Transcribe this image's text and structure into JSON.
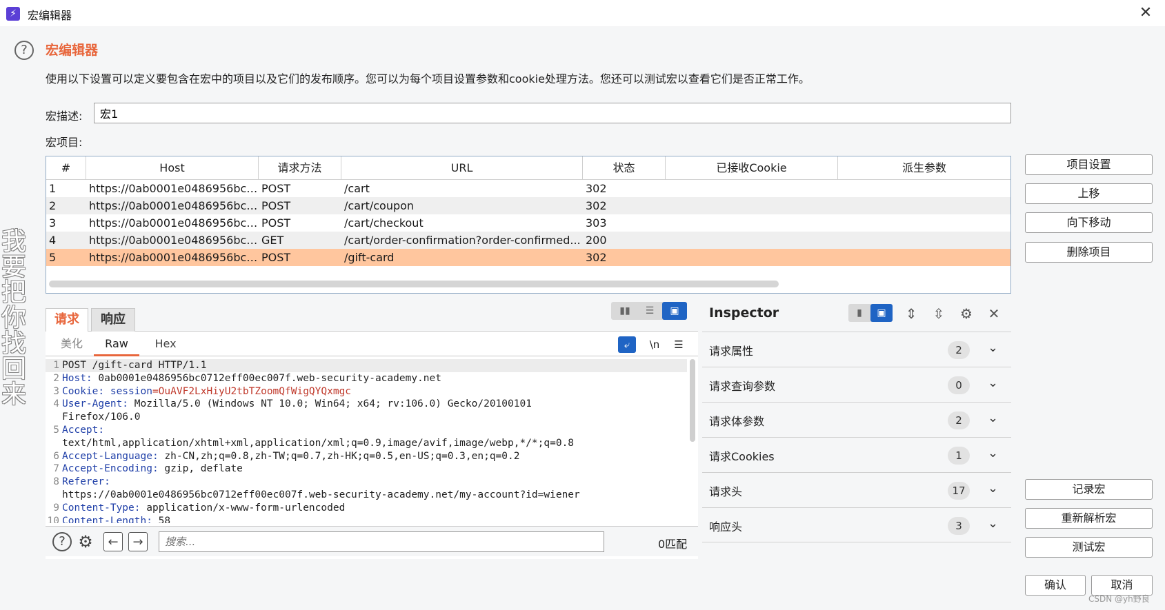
{
  "window": {
    "title": "宏编辑器",
    "close_glyph": "✕"
  },
  "header": {
    "help_glyph": "?",
    "heading": "宏编辑器",
    "description": "使用以下设置可以定义要包含在宏中的项目以及它们的发布顺序。您可以为每个项目设置参数和cookie处理方法。您还可以测试宏以查看它们是否正常工作。"
  },
  "form": {
    "desc_label": "宏描述:",
    "desc_value": "宏1",
    "items_label": "宏项目:"
  },
  "table": {
    "columns": [
      "#",
      "Host",
      "请求方法",
      "URL",
      "状态",
      "已接收Cookie",
      "派生参数"
    ],
    "rows": [
      [
        "1",
        "https://0ab0001e0486956bc07...",
        "POST",
        "/cart",
        "302",
        "",
        ""
      ],
      [
        "2",
        "https://0ab0001e0486956bc07...",
        "POST",
        "/cart/coupon",
        "302",
        "",
        ""
      ],
      [
        "3",
        "https://0ab0001e0486956bc07...",
        "POST",
        "/cart/checkout",
        "303",
        "",
        ""
      ],
      [
        "4",
        "https://0ab0001e0486956bc07...",
        "GET",
        "/cart/order-confirmation?order-confirmed...",
        "200",
        "",
        ""
      ],
      [
        "5",
        "https://0ab0001e0486956bc07...",
        "POST",
        "/gift-card",
        "302",
        "",
        ""
      ]
    ],
    "selected_row": 5
  },
  "side_buttons": {
    "item_settings": "项目设置",
    "move_up": "上移",
    "move_down": "向下移动",
    "delete_item": "删除项目",
    "record_macro": "记录宏",
    "reparse_macro": "重新解析宏",
    "test_macro": "测试宏",
    "ok": "确认",
    "cancel": "取消"
  },
  "watermark": "我要把你找回来",
  "request_panel": {
    "tabs": {
      "request": "请求",
      "response": "响应"
    },
    "subtabs": {
      "pretty": "美化",
      "raw": "Raw",
      "hex": "Hex"
    },
    "newline_toggle": "\\n",
    "menu_glyph": "☰",
    "lines": [
      {
        "n": "1",
        "key": "",
        "val": "POST /gift-card HTTP/1.1"
      },
      {
        "n": "2",
        "key": "Host:",
        "val": " 0ab0001e0486956bc0712eff00ec007f.web-security-academy.net"
      },
      {
        "n": "3",
        "key": "Cookie:",
        "val": " ",
        "cookie_name": "session",
        "cookie_value": "=OuAVF2LxHiyU2tbTZoomQfWigQYQxmgc"
      },
      {
        "n": "4",
        "key": "User-Agent:",
        "val": " Mozilla/5.0 (Windows NT 10.0; Win64; x64; rv:106.0) Gecko/20100101"
      },
      {
        "n": "",
        "key": "",
        "val": "Firefox/106.0"
      },
      {
        "n": "5",
        "key": "Accept:",
        "val": ""
      },
      {
        "n": "",
        "key": "",
        "val": "text/html,application/xhtml+xml,application/xml;q=0.9,image/avif,image/webp,*/*;q=0.8"
      },
      {
        "n": "6",
        "key": "Accept-Language:",
        "val": " zh-CN,zh;q=0.8,zh-TW;q=0.7,zh-HK;q=0.5,en-US;q=0.3,en;q=0.2"
      },
      {
        "n": "7",
        "key": "Accept-Encoding:",
        "val": " gzip, deflate"
      },
      {
        "n": "8",
        "key": "Referer:",
        "val": ""
      },
      {
        "n": "",
        "key": "",
        "val": "https://0ab0001e0486956bc0712eff00ec007f.web-security-academy.net/my-account?id=wiener"
      },
      {
        "n": "9",
        "key": "Content-Type:",
        "val": " application/x-www-form-urlencoded"
      },
      {
        "n": "10",
        "key": "Content-Length:",
        "val": " 58"
      }
    ],
    "search": {
      "placeholder": "搜索...",
      "match_count": "0匹配",
      "help_glyph": "?",
      "gear_glyph": "⚙",
      "prev_glyph": "←",
      "next_glyph": "→"
    }
  },
  "inspector": {
    "title": "Inspector",
    "gear_glyph": "⚙",
    "close_glyph": "✕",
    "sections": [
      {
        "label": "请求属性",
        "count": "2"
      },
      {
        "label": "请求查询参数",
        "count": "0"
      },
      {
        "label": "请求体参数",
        "count": "2"
      },
      {
        "label": "请求Cookies",
        "count": "1"
      },
      {
        "label": "请求头",
        "count": "17"
      },
      {
        "label": "响应头",
        "count": "3"
      }
    ],
    "chevron_glyph": "⌄"
  },
  "credit": "CSDN @yh野良",
  "colors": {
    "accent": "#e8663c",
    "selected_row": "#ffc69e",
    "primary_blue": "#1f64c4",
    "header_key": "#1f3fa8",
    "cookie_value": "#c0392b"
  }
}
